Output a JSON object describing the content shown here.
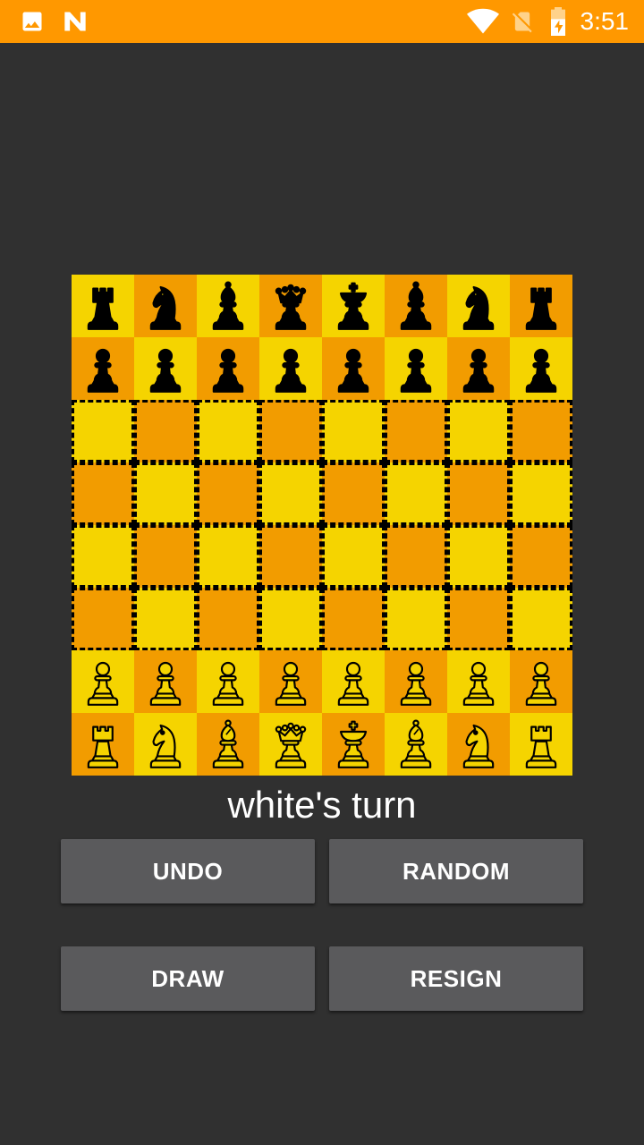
{
  "status_bar": {
    "time": "3:51",
    "background": "#FF9800",
    "icons": [
      "image-icon",
      "n-logo-icon",
      "wifi-icon",
      "no-sim-icon",
      "battery-charging-icon"
    ]
  },
  "board": {
    "light_color": "#F5D400",
    "dark_color": "#F29C00",
    "black_piece_color": "#000000",
    "white_piece_fill": "#F5D400",
    "white_piece_outline": "#000000",
    "empty_square_border": "dashed-black",
    "ranks": [
      [
        "br",
        "bn",
        "bb",
        "bq",
        "bk",
        "bb",
        "bn",
        "br"
      ],
      [
        "bp",
        "bp",
        "bp",
        "bp",
        "bp",
        "bp",
        "bp",
        "bp"
      ],
      [
        "",
        "",
        "",
        "",
        "",
        "",
        "",
        ""
      ],
      [
        "",
        "",
        "",
        "",
        "",
        "",
        "",
        ""
      ],
      [
        "",
        "",
        "",
        "",
        "",
        "",
        "",
        ""
      ],
      [
        "",
        "",
        "",
        "",
        "",
        "",
        "",
        ""
      ],
      [
        "wp",
        "wp",
        "wp",
        "wp",
        "wp",
        "wp",
        "wp",
        "wp"
      ],
      [
        "wr",
        "wn",
        "wb",
        "wq",
        "wk",
        "wb",
        "wn",
        "wr"
      ]
    ]
  },
  "status": {
    "turn": "white's turn"
  },
  "buttons": {
    "undo": "UNDO",
    "random": "RANDOM",
    "draw": "DRAW",
    "resign": "RESIGN"
  }
}
